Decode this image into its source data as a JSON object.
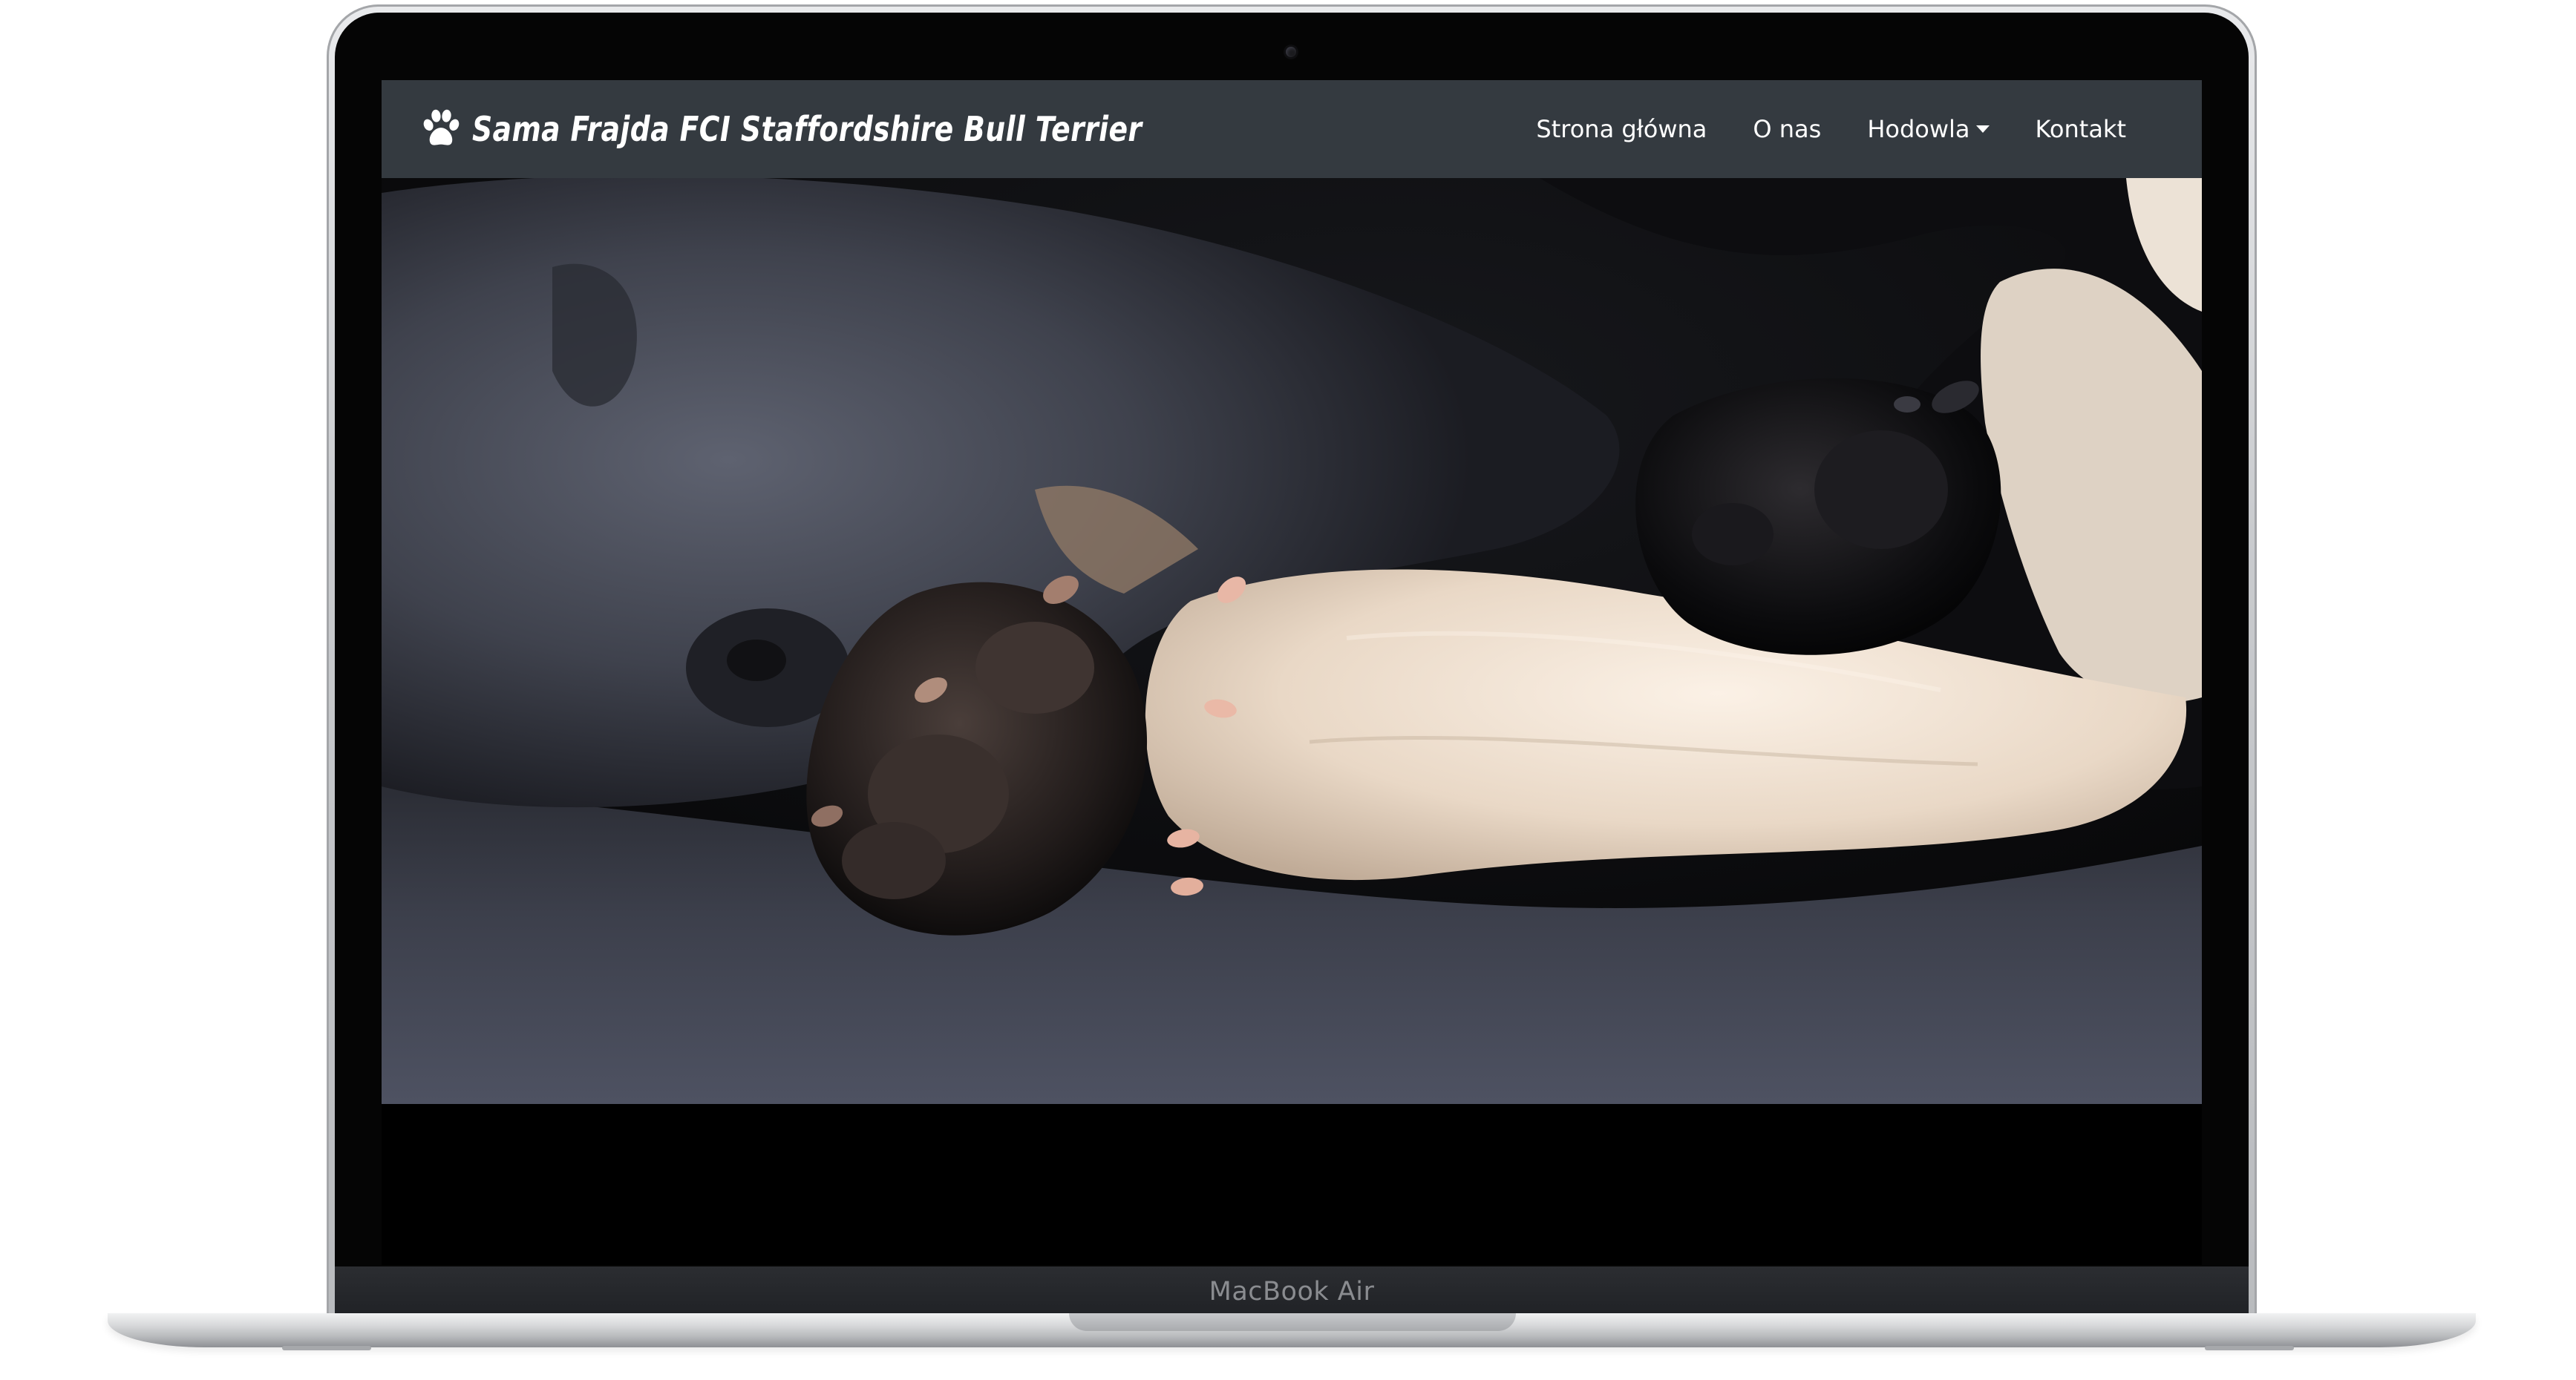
{
  "device": {
    "label": "MacBook Air"
  },
  "site": {
    "brand": "Sama Frajda FCI Staffordshire Bull Terrier",
    "brand_icon": "paw-icon"
  },
  "nav": {
    "items": [
      {
        "label": "Strona główna"
      },
      {
        "label": "O nas"
      },
      {
        "label": "Hodowla",
        "dropdown": true
      },
      {
        "label": "Kontakt"
      }
    ]
  },
  "hero": {
    "image": "sleeping-puppies-paws-photo"
  },
  "colors": {
    "navbar": "#343a40",
    "nav_text": "#ffffff"
  }
}
